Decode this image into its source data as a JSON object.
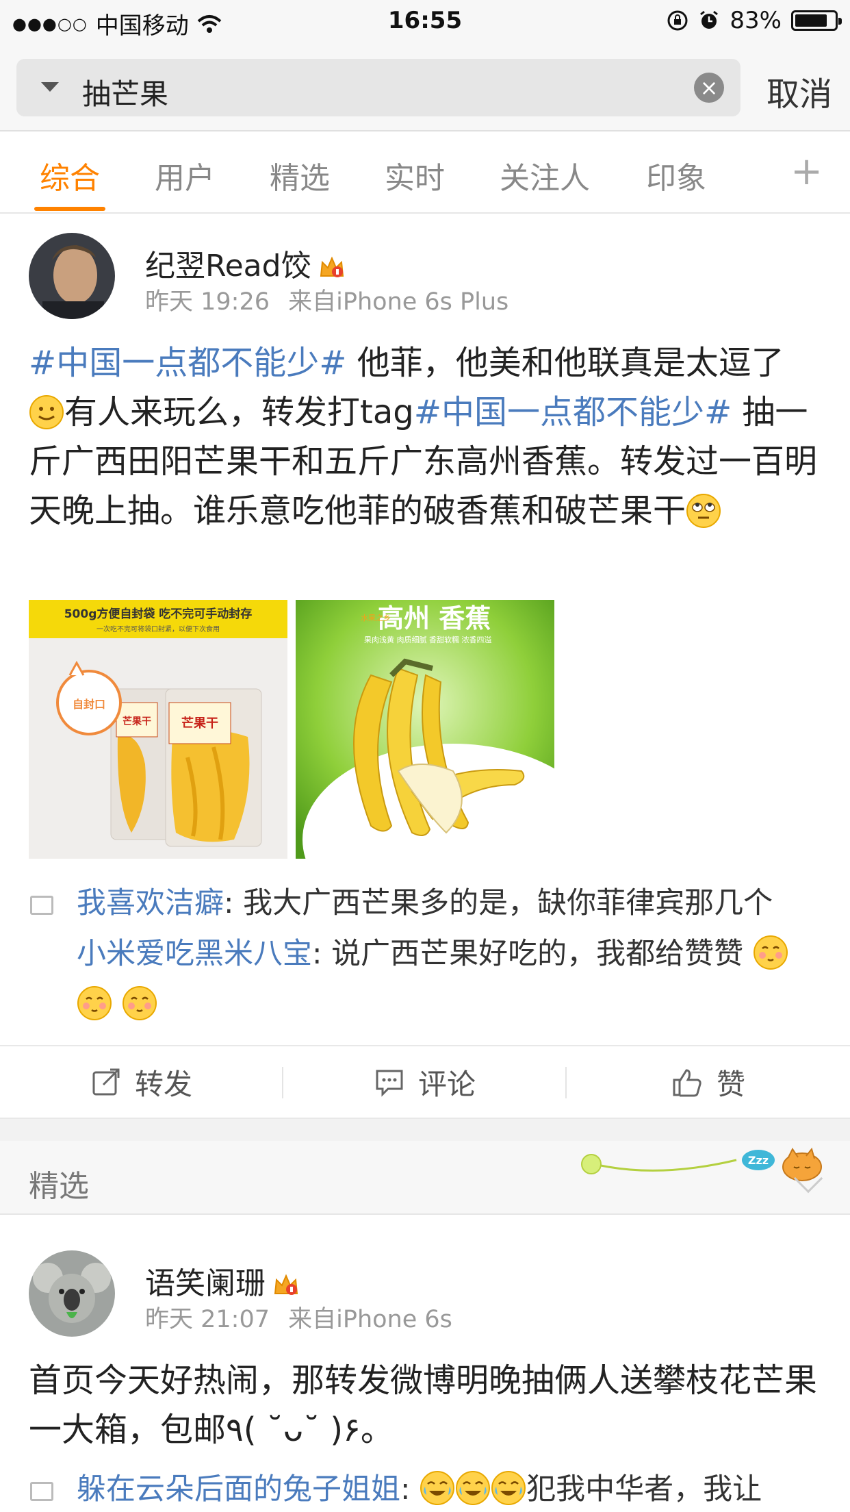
{
  "status_bar": {
    "signal": "●●●○○",
    "carrier": "中国移动",
    "time": "16:55",
    "battery": "83%",
    "battery_level": 0.83
  },
  "search": {
    "query": "抽芒果",
    "cancel_label": "取消"
  },
  "tabs": [
    {
      "label": "综合",
      "active": true
    },
    {
      "label": "用户"
    },
    {
      "label": "精选"
    },
    {
      "label": "实时"
    },
    {
      "label": "关注人"
    },
    {
      "label": "印象"
    }
  ],
  "post1": {
    "username": "纪翌Read饺",
    "time": "昨天 19:26",
    "source": "来自iPhone 6s Plus",
    "hashtag": "#中国一点都不能少#",
    "text_1": " 他菲，他美和他联真是太逗了",
    "text_2": "有人来玩么，转发打tag",
    "text_3": " 抽一斤广西田阳芒果干和五斤广东高州香蕉。转发过一百明天晚上抽。谁乐意吃他菲的破香蕉和破芒果干",
    "image1": {
      "banner": "500g方便自封袋 吃不完可手动封存",
      "sub": "一次吃不完可将袋口封紧，以便下次食用",
      "seal": "自封口",
      "pack_label": "芒果干"
    },
    "image2": {
      "title": "高州 香蕉",
      "side": "水果之乡",
      "sub": "果肉浅黄  肉质细腻  香甜软糯  浓香四溢"
    },
    "comments": [
      {
        "user": "我喜欢洁癖",
        "text": ": 我大广西芒果多的是，缺你菲律宾那几个"
      },
      {
        "user": "小米爱吃黑米八宝",
        "text": ": 说广西芒果好吃的，我都给赞赞"
      }
    ]
  },
  "actions": {
    "repost": "转发",
    "comment": "评论",
    "like": "赞"
  },
  "section": {
    "label": "精选",
    "zzz": "Zzz"
  },
  "post2": {
    "username": "语笑阑珊",
    "time": "昨天 21:07",
    "source": "来自iPhone 6s",
    "text": "首页今天好热闹，那转发微博明晚抽俩人送攀枝花芒果一大箱，包邮٩( ˘ᴗ˘ )۶。",
    "comment_user": "躲在云朵后面的兔子姐姐",
    "comment_text": "犯我中华者，我让"
  },
  "colors": {
    "accent": "#ff8200",
    "link": "#4a7bbd"
  }
}
